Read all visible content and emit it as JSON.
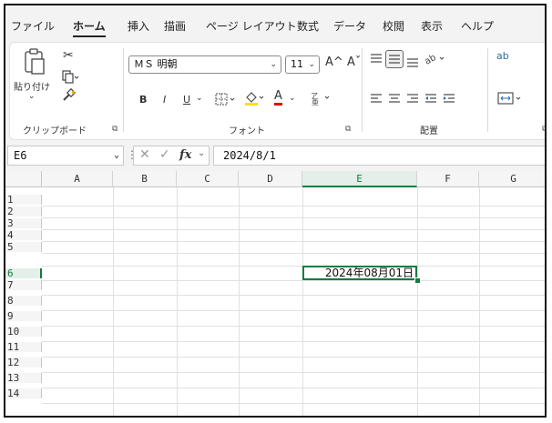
{
  "tabs": [
    {
      "label": "ファイル"
    },
    {
      "label": "ホーム"
    },
    {
      "label": "挿入"
    },
    {
      "label": "描画"
    },
    {
      "label": "ページ レイアウト"
    },
    {
      "label": "数式"
    },
    {
      "label": "データ"
    },
    {
      "label": "校閲"
    },
    {
      "label": "表示"
    },
    {
      "label": "ヘルプ"
    }
  ],
  "ribbon": {
    "clipboard": {
      "paste_label": "貼り付け",
      "group_label": "クリップボード"
    },
    "font": {
      "font_name": "ＭＳ 明朝",
      "font_size": "11",
      "bold": "B",
      "italic": "I",
      "underline": "U",
      "grow": "A^",
      "shrink": "Aˇ",
      "font_color": "A",
      "group_label": "フォント"
    },
    "alignment": {
      "group_label": "配置",
      "wrap": "ab"
    },
    "accent_color": "#107c41"
  },
  "formula_bar": {
    "name_box": "E6",
    "fx": "fx",
    "formula": "2024/8/1"
  },
  "grid": {
    "columns": [
      "A",
      "B",
      "C",
      "D",
      "E",
      "F",
      "G"
    ],
    "rows": [
      "1",
      "2",
      "3",
      "4",
      "5",
      "6",
      "7",
      "8",
      "9",
      "10",
      "11",
      "12",
      "13",
      "14"
    ],
    "active_cell": {
      "ref": "E6",
      "display": "2024年08月01日"
    }
  }
}
